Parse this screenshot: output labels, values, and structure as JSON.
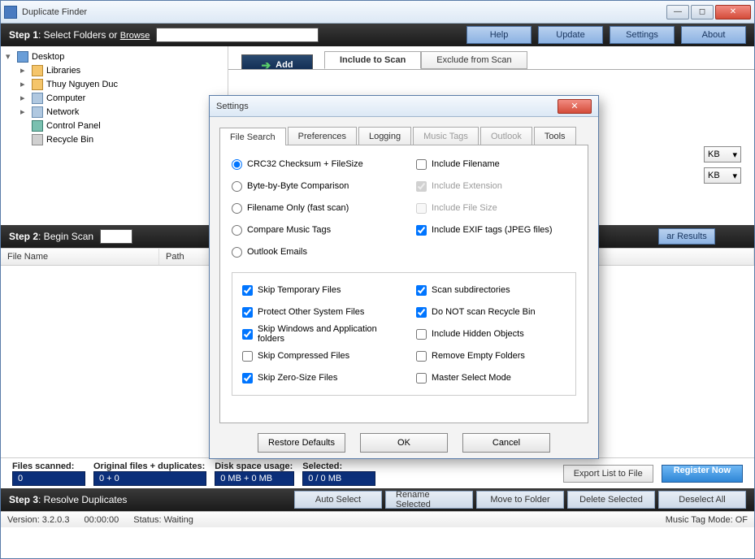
{
  "window": {
    "title": "Duplicate Finder"
  },
  "step1": {
    "label_bold": "Step 1",
    "label_rest": ": Select Folders or ",
    "browse": "Browse",
    "buttons": {
      "help": "Help",
      "update": "Update",
      "settings": "Settings",
      "about": "About"
    }
  },
  "tree": {
    "desktop": "Desktop",
    "items": [
      {
        "label": "Libraries"
      },
      {
        "label": "Thuy Nguyen Duc"
      },
      {
        "label": "Computer"
      },
      {
        "label": "Network"
      },
      {
        "label": "Control Panel"
      },
      {
        "label": "Recycle Bin"
      }
    ]
  },
  "add_button": "Add",
  "scan_tabs": {
    "include": "Include to Scan",
    "exclude": "Exclude from Scan"
  },
  "kb_label": "KB",
  "step2": {
    "label_bold": "Step 2",
    "label_rest": ": Begin Scan",
    "clear": "ar Results"
  },
  "columns": {
    "file": "File Name",
    "path": "Path"
  },
  "stats": {
    "scanned_lbl": "Files scanned:",
    "scanned_val": "0",
    "orig_lbl": "Original files + duplicates:",
    "orig_val": "0 + 0",
    "disk_lbl": "Disk space usage:",
    "disk_val": "0 MB + 0 MB",
    "sel_lbl": "Selected:",
    "sel_val": "0 / 0 MB",
    "export": "Export List to File",
    "register": "Register Now"
  },
  "step3": {
    "label_bold": "Step 3",
    "label_rest": ": Resolve Duplicates",
    "buttons": {
      "auto": "Auto Select",
      "rename": "Rename Selected",
      "move": "Move to Folder",
      "delete": "Delete Selected",
      "deselect": "Deselect All"
    }
  },
  "status": {
    "version": "Version: 3.2.0.3",
    "time": "00:00:00",
    "state": "Status: Waiting",
    "music": "Music Tag Mode: OF"
  },
  "dialog": {
    "title": "Settings",
    "tabs": {
      "file_search": "File Search",
      "preferences": "Preferences",
      "logging": "Logging",
      "music_tags": "Music Tags",
      "outlook": "Outlook",
      "tools": "Tools"
    },
    "radios": {
      "crc": "CRC32 Checksum + FileSize",
      "byte": "Byte-by-Byte Comparison",
      "filename": "Filename Only (fast scan)",
      "music": "Compare Music Tags",
      "outlook": "Outlook Emails"
    },
    "top_checks": {
      "inc_filename": "Include Filename",
      "inc_ext": "Include Extension",
      "inc_size": "Include File Size",
      "inc_exif": "Include EXIF tags (JPEG files)"
    },
    "group_checks": {
      "skip_temp": "Skip Temporary Files",
      "protect_sys": "Protect Other System Files",
      "skip_win": "Skip Windows and Application folders",
      "skip_comp": "Skip Compressed Files",
      "skip_zero": "Skip Zero-Size Files",
      "scan_sub": "Scan subdirectories",
      "no_recycle": "Do NOT scan Recycle Bin",
      "inc_hidden": "Include Hidden Objects",
      "rm_empty": "Remove Empty Folders",
      "master": "Master Select Mode"
    },
    "buttons": {
      "restore": "Restore Defaults",
      "ok": "OK",
      "cancel": "Cancel"
    }
  }
}
